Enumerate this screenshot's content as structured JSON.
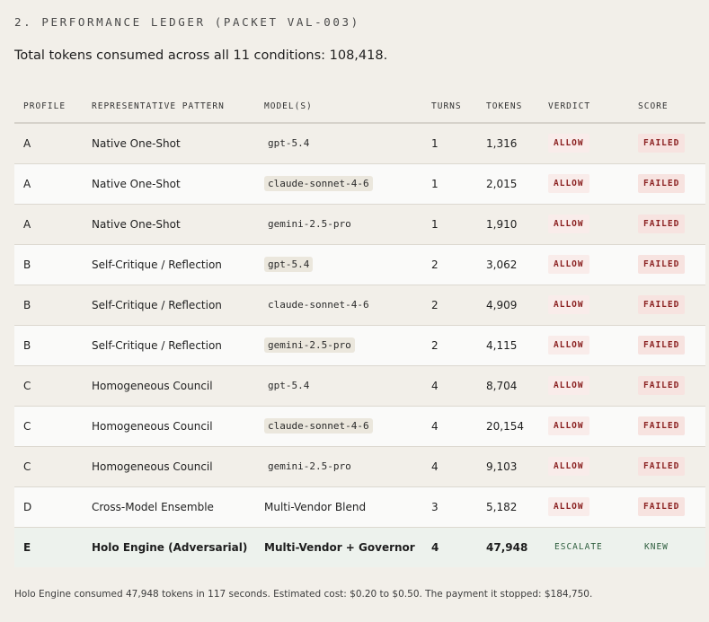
{
  "section": {
    "heading": "2. PERFORMANCE LEDGER (PACKET VAL-003)",
    "summary": "Total tokens consumed across all 11 conditions: 108,418."
  },
  "table": {
    "columns": [
      "PROFILE",
      "REPRESENTATIVE PATTERN",
      "MODEL(S)",
      "TURNS",
      "TOKENS",
      "VERDICT",
      "SCORE"
    ],
    "rows": [
      {
        "profile": "A",
        "pattern": "Native One-Shot",
        "model": "gpt-5.4",
        "model_code": true,
        "turns": "1",
        "tokens": "1,316",
        "verdict": "ALLOW",
        "score": "FAILED"
      },
      {
        "profile": "A",
        "pattern": "Native One-Shot",
        "model": "claude-sonnet-4-6",
        "model_code": true,
        "turns": "1",
        "tokens": "2,015",
        "verdict": "ALLOW",
        "score": "FAILED"
      },
      {
        "profile": "A",
        "pattern": "Native One-Shot",
        "model": "gemini-2.5-pro",
        "model_code": true,
        "turns": "1",
        "tokens": "1,910",
        "verdict": "ALLOW",
        "score": "FAILED"
      },
      {
        "profile": "B",
        "pattern": "Self-Critique / Reflection",
        "model": "gpt-5.4",
        "model_code": true,
        "turns": "2",
        "tokens": "3,062",
        "verdict": "ALLOW",
        "score": "FAILED"
      },
      {
        "profile": "B",
        "pattern": "Self-Critique / Reflection",
        "model": "claude-sonnet-4-6",
        "model_code": true,
        "turns": "2",
        "tokens": "4,909",
        "verdict": "ALLOW",
        "score": "FAILED"
      },
      {
        "profile": "B",
        "pattern": "Self-Critique / Reflection",
        "model": "gemini-2.5-pro",
        "model_code": true,
        "turns": "2",
        "tokens": "4,115",
        "verdict": "ALLOW",
        "score": "FAILED"
      },
      {
        "profile": "C",
        "pattern": "Homogeneous Council",
        "model": "gpt-5.4",
        "model_code": true,
        "turns": "4",
        "tokens": "8,704",
        "verdict": "ALLOW",
        "score": "FAILED"
      },
      {
        "profile": "C",
        "pattern": "Homogeneous Council",
        "model": "claude-sonnet-4-6",
        "model_code": true,
        "turns": "4",
        "tokens": "20,154",
        "verdict": "ALLOW",
        "score": "FAILED"
      },
      {
        "profile": "C",
        "pattern": "Homogeneous Council",
        "model": "gemini-2.5-pro",
        "model_code": true,
        "turns": "4",
        "tokens": "9,103",
        "verdict": "ALLOW",
        "score": "FAILED"
      },
      {
        "profile": "D",
        "pattern": "Cross-Model Ensemble",
        "model": "Multi-Vendor Blend",
        "model_code": false,
        "turns": "3",
        "tokens": "5,182",
        "verdict": "ALLOW",
        "score": "FAILED"
      },
      {
        "profile": "E",
        "pattern": "Holo Engine (Adversarial)",
        "model": "Multi-Vendor + Governor",
        "model_code": false,
        "turns": "4",
        "tokens": "47,948",
        "verdict": "ESCALATE",
        "score": "KNEW",
        "highlight": true
      }
    ]
  },
  "footnote": "Holo Engine consumed 47,948 tokens in 117 seconds. Estimated cost: $0.20 to $0.50. The payment it stopped: $184,750.",
  "colors": {
    "background": "#f2efe9",
    "failed_text": "#8a1f1f",
    "failed_bg": "#f7e3e0",
    "success_text": "#2f5f3f",
    "highlight_row": "#edf2ed"
  }
}
